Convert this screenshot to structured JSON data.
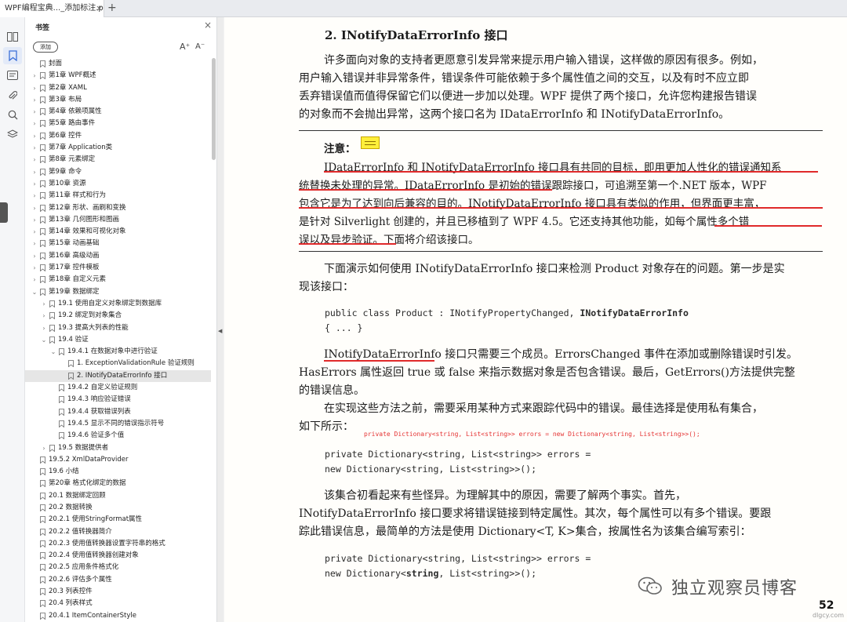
{
  "tab": {
    "title": "WPF编程宝典..._添加标注.pdf",
    "close": "×",
    "add": "+"
  },
  "rail": {
    "icons": [
      "thumbnail-icon",
      "bookmark-icon",
      "comment-icon",
      "attachment-icon",
      "search-icon",
      "layers-icon"
    ]
  },
  "panel": {
    "title": "书签",
    "close": "×",
    "add_label": "添加",
    "font_increase": "A⁺",
    "font_decrease": "A⁻",
    "items": [
      {
        "label": "封面",
        "level": 0,
        "chev": ""
      },
      {
        "label": "第1章 WPF概述",
        "level": 0,
        "chev": "›"
      },
      {
        "label": "第2章 XAML",
        "level": 0,
        "chev": "›"
      },
      {
        "label": "第3章 布局",
        "level": 0,
        "chev": "›"
      },
      {
        "label": "第4章 依赖项属性",
        "level": 0,
        "chev": "›"
      },
      {
        "label": "第5章 路由事件",
        "level": 0,
        "chev": "›"
      },
      {
        "label": "第6章 控件",
        "level": 0,
        "chev": "›"
      },
      {
        "label": "第7章 Application类",
        "level": 0,
        "chev": "›"
      },
      {
        "label": "第8章 元素绑定",
        "level": 0,
        "chev": "›"
      },
      {
        "label": "第9章 命令",
        "level": 0,
        "chev": "›"
      },
      {
        "label": "第10章 资源",
        "level": 0,
        "chev": "›"
      },
      {
        "label": "第11章 样式和行为",
        "level": 0,
        "chev": "›"
      },
      {
        "label": "第12章 形状、画刷和变换",
        "level": 0,
        "chev": "›"
      },
      {
        "label": "第13章 几何图形和图画",
        "level": 0,
        "chev": "›"
      },
      {
        "label": "第14章 效果和可视化对象",
        "level": 0,
        "chev": "›"
      },
      {
        "label": "第15章 动画基础",
        "level": 0,
        "chev": "›"
      },
      {
        "label": "第16章 高级动画",
        "level": 0,
        "chev": "›"
      },
      {
        "label": "第17章 控件模板",
        "level": 0,
        "chev": "›"
      },
      {
        "label": "第18章 自定义元素",
        "level": 0,
        "chev": "›"
      },
      {
        "label": "第19章 数据绑定",
        "level": 0,
        "chev": "⌄"
      },
      {
        "label": "19.1 使用自定义对象绑定到数据库",
        "level": 1,
        "chev": "›"
      },
      {
        "label": "19.2 绑定到对象集合",
        "level": 1,
        "chev": "›"
      },
      {
        "label": "19.3 提高大列表的性能",
        "level": 1,
        "chev": "›"
      },
      {
        "label": "19.4 验证",
        "level": 1,
        "chev": "⌄"
      },
      {
        "label": "19.4.1 在数据对象中进行验证",
        "level": 2,
        "chev": "⌄"
      },
      {
        "label": "1. ExceptionValidationRule  验证规则",
        "level": 3,
        "chev": ""
      },
      {
        "label": "2. INotifyDataErrorInfo  接口",
        "level": 3,
        "chev": "",
        "selected": true
      },
      {
        "label": "19.4.2 自定义验证规则",
        "level": 2,
        "chev": ""
      },
      {
        "label": "19.4.3 响应验证错误",
        "level": 2,
        "chev": ""
      },
      {
        "label": "19.4.4 获取错误列表",
        "level": 2,
        "chev": ""
      },
      {
        "label": "19.4.5 显示不同的错误指示符号",
        "level": 2,
        "chev": ""
      },
      {
        "label": "19.4.6 验证多个值",
        "level": 2,
        "chev": ""
      },
      {
        "label": "19.5 数据提供者",
        "level": 1,
        "chev": "›"
      },
      {
        "label": "19.5.2 XmlDataProvider",
        "level": 0,
        "chev": ""
      },
      {
        "label": "19.6 小结",
        "level": 0,
        "chev": ""
      },
      {
        "label": "第20章 格式化绑定的数据",
        "level": 0,
        "chev": ""
      },
      {
        "label": "20.1 数据绑定回顾",
        "level": 0,
        "chev": ""
      },
      {
        "label": "20.2 数据转换",
        "level": 0,
        "chev": ""
      },
      {
        "label": "20.2.1 使用StringFormat属性",
        "level": 0,
        "chev": ""
      },
      {
        "label": "20.2.2 值转换器简介",
        "level": 0,
        "chev": ""
      },
      {
        "label": "20.2.3 使用值转换器设置字符串的格式",
        "level": 0,
        "chev": ""
      },
      {
        "label": "20.2.4 使用值转换器创建对象",
        "level": 0,
        "chev": ""
      },
      {
        "label": "20.2.5 应用条件格式化",
        "level": 0,
        "chev": ""
      },
      {
        "label": "20.2.6 评估多个属性",
        "level": 0,
        "chev": ""
      },
      {
        "label": "20.3 列表控件",
        "level": 0,
        "chev": ""
      },
      {
        "label": "20.4 列表样式",
        "level": 0,
        "chev": ""
      },
      {
        "label": "20.4.1 ItemContainerStyle",
        "level": 0,
        "chev": ""
      }
    ]
  },
  "doc": {
    "heading": "2. INotifyDataErrorInfo 接口",
    "para1": [
      "许多面向对象的支持者更愿意引发异常来提示用户输入错误，这样做的原因有很多。例如，",
      "用户输入错误并非异常条件，错误条件可能依赖于多个属性值之间的交互，以及有时不应立即",
      "丢弃错误值而值得保留它们以便进一步加以处理。WPF 提供了两个接口，允许您构建报告错误",
      "的对象而不会抛出异常，这两个接口名为 IDataErrorInfo 和 INotifyDataErrorInfo。"
    ],
    "note_label": "注意：",
    "note": [
      "IDataErrorInfo 和 INotifyDataErrorInfo 接口具有共同的目标，即用更加人性化的错误通知系",
      "统替换未处理的异常。IDataErrorInfo 是初始的错误跟踪接口，可追溯至第一个.NET 版本，WPF",
      "包含它是为了达到向后兼容的目的。INotifyDataErrorInfo 接口具有类似的作用，但界面更丰富，",
      "是针对 Silverlight 创建的，并且已移植到了 WPF 4.5。它还支持其他功能，如每个属性多个错",
      "误以及异步验证。下面将介绍该接口。"
    ],
    "para2": [
      "下面演示如何使用 INotifyDataErrorInfo 接口来检测 Product 对象存在的问题。第一步是实",
      "现该接口："
    ],
    "code1": {
      "pre": "public class Product : INotifyPropertyChanged, ",
      "bold": "INotifyDataErrorInfo",
      "line2": "{ ... }"
    },
    "para3": [
      "INotifyDataErrorInfo 接口只需要三个成员。ErrorsChanged 事件在添加或删除错误时引发。",
      "HasErrors 属性返回 true 或 false 来指示数据对象是否包含错误。最后，GetErrors()方法提供完整",
      "的错误信息。",
      "在实现这些方法之前，需要采用某种方式来跟踪代码中的错误。最佳选择是使用私有集合，",
      "如下所示："
    ],
    "red_annotation": "private Dictionary<string, List<string>> errors = new Dictionary<string, List<string>>();",
    "code2": [
      "private Dictionary<string, List<string>> errors =",
      "  new Dictionary<string, List<string>>();"
    ],
    "para4": [
      "该集合初看起来有些怪异。为理解其中的原因，需要了解两个事实。首先，",
      "INotifyDataErrorInfo 接口要求将错误链接到特定属性。其次，每个属性可以有多个错误。要跟",
      "踪此错误信息，最简单的方法是使用 Dictionary<T, K>集合，按属性名为该集合编写索引："
    ],
    "code3": {
      "line1": "private Dictionary<string, List<string>> errors =",
      "line2_pre": "  new Dictionary<",
      "line2_bold": "string",
      "line2_post": ", List<string>>();"
    },
    "page_number": "52",
    "watermark": "独立观察员博客",
    "site": "dlgcy.com"
  },
  "colors": {
    "accent": "#3b6fd8",
    "annotation_red": "#e02a2a",
    "sticky": "#ffef3a",
    "selected_row": "#e6e6e6"
  }
}
